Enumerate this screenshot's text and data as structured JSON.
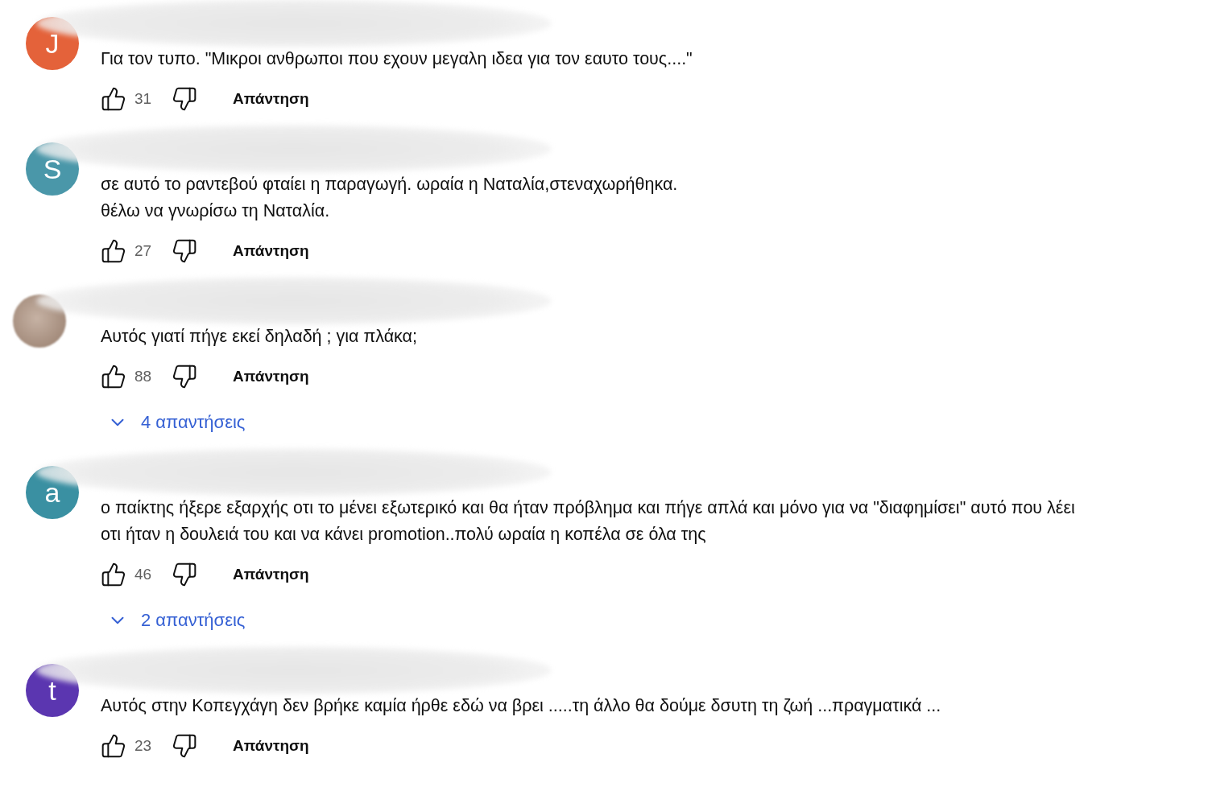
{
  "comments": [
    {
      "avatar": {
        "kind": "letter",
        "letter": "J",
        "color": "#e4623a"
      },
      "text": "Για τον τυπο. \"Μικροι ανθρωποι που εχουν μεγαλη ιδεα για τον εαυτο τους....\"",
      "likes": "31",
      "reply_button": "Απάντηση"
    },
    {
      "avatar": {
        "kind": "letter",
        "letter": "S",
        "color": "#4a97a9"
      },
      "text": "σε αυτό το ραντεβού φταίει η παραγωγή. ωραία η Ναταλία,στεναχωρήθηκα.\nθέλω να γνωρίσω τη Ναταλία.",
      "likes": "27",
      "reply_button": "Απάντηση"
    },
    {
      "avatar": {
        "kind": "photo"
      },
      "text": "Αυτός γιατί πήγε εκεί δηλαδή ; για πλάκα;",
      "likes": "88",
      "reply_button": "Απάντηση",
      "replies": "4 απαντήσεις"
    },
    {
      "avatar": {
        "kind": "letter",
        "letter": "a",
        "color": "#3a90a2"
      },
      "text": "ο παίκτης ήξερε εξαρχής οτι το μένει εξωτερικό και θα ήταν πρόβλημα και πήγε απλά και μόνο για να \"διαφημίσει\" αυτό που λέει\nοτι ήταν η δουλειά του και να κάνει promotion..πολύ ωραία η κοπέλα σε όλα της",
      "likes": "46",
      "reply_button": "Απάντηση",
      "replies": "2 απαντήσεις"
    },
    {
      "avatar": {
        "kind": "letter",
        "letter": "t",
        "color": "#5b36b0"
      },
      "text": "Αυτός στην Κοπεγχάγη δεν βρήκε καμία ήρθε εδώ να βρει .....τη άλλο θα δούμε δσυτη τη ζωή ...πραγματικά ...",
      "likes": "23",
      "reply_button": "Απάντηση"
    }
  ]
}
